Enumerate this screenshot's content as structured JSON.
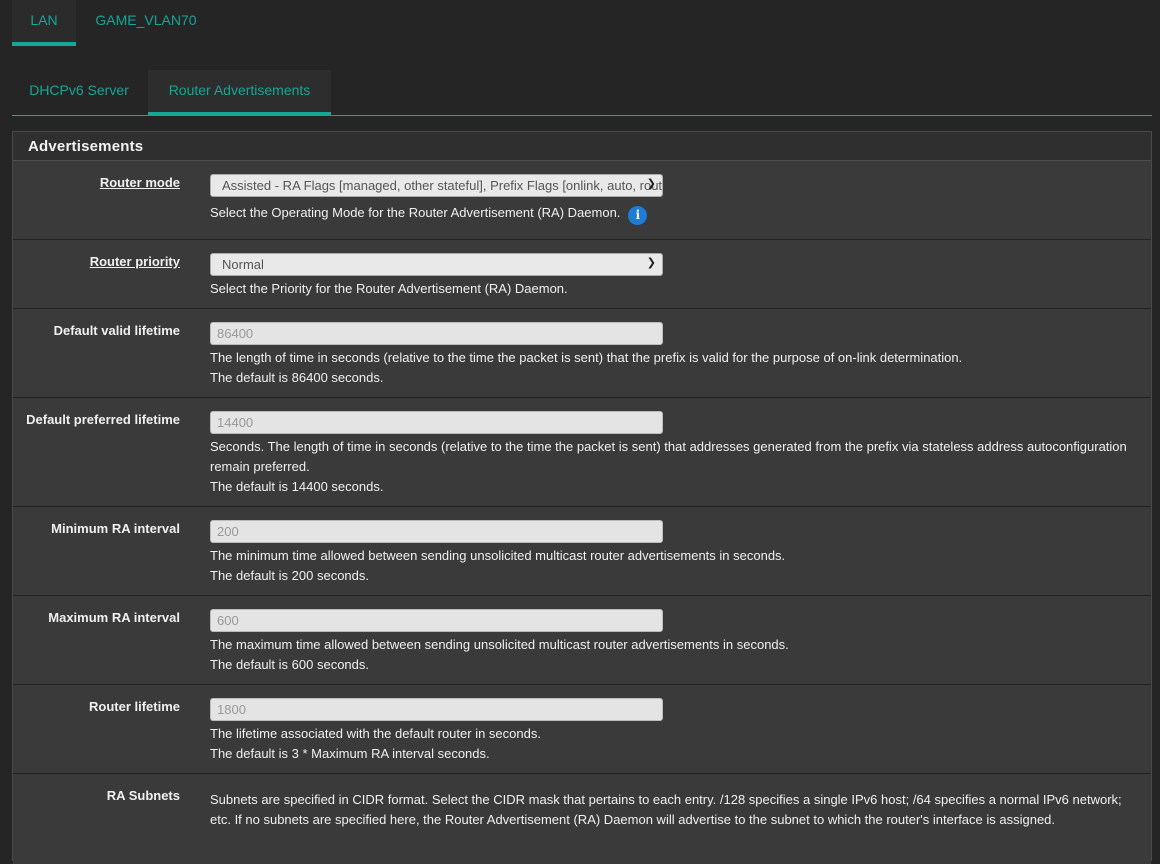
{
  "tabs_interfaces": [
    {
      "label": "LAN",
      "active": true
    },
    {
      "label": "GAME_VLAN70",
      "active": false
    }
  ],
  "tabs_services": [
    {
      "label": "DHCPv6 Server",
      "active": false
    },
    {
      "label": "Router Advertisements",
      "active": true
    }
  ],
  "panel": {
    "title": "Advertisements",
    "rows": [
      {
        "label": "Router mode",
        "select_value": "Assisted - RA Flags [managed, other stateful], Prefix Flags [onlink, auto, router]",
        "help1": "Select the Operating Mode for the Router Advertisement (RA) Daemon."
      },
      {
        "label": "Router priority",
        "select_value": "Normal",
        "help1": "Select the Priority for the Router Advertisement (RA) Daemon."
      },
      {
        "label": "Default valid lifetime",
        "placeholder": "86400",
        "help1": "The length of time in seconds (relative to the time the packet is sent) that the prefix is valid for the purpose of on-link determination.",
        "help2": "The default is 86400 seconds."
      },
      {
        "label": "Default preferred lifetime",
        "placeholder": "14400",
        "help1": "Seconds. The length of time in seconds (relative to the time the packet is sent) that addresses generated from the prefix via stateless address autoconfiguration remain preferred.",
        "help2": "The default is 14400 seconds."
      },
      {
        "label": "Minimum RA interval",
        "placeholder": "200",
        "help1": "The minimum time allowed between sending unsolicited multicast router advertisements in seconds.",
        "help2": "The default is 200 seconds."
      },
      {
        "label": "Maximum RA interval",
        "placeholder": "600",
        "help1": "The maximum time allowed between sending unsolicited multicast router advertisements in seconds.",
        "help2": "The default is 600 seconds."
      },
      {
        "label": "Router lifetime",
        "placeholder": "1800",
        "help1": "The lifetime associated with the default router in seconds.",
        "help2": "The default is 3 * Maximum RA interval seconds."
      },
      {
        "label": "RA Subnets",
        "help1": "Subnets are specified in CIDR format. Select the CIDR mask that pertains to each entry. /128 specifies a single IPv6 host; /64 specifies a normal IPv6 network; etc. If no subnets are specified here, the Router Advertisement (RA) Daemon will advertise to the subnet to which the router's interface is assigned."
      }
    ]
  },
  "colors": {
    "accent": "#15a696",
    "info": "#1e7bd6"
  },
  "icons": {
    "select_arrow": "chevron-down-icon",
    "info": "info-icon"
  }
}
